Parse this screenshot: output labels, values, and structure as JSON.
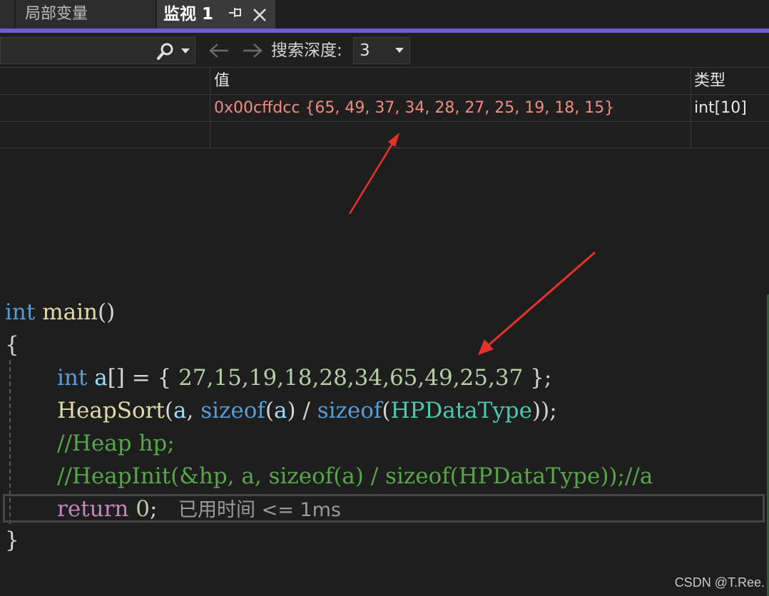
{
  "tabs": {
    "locals_label": "局部变量",
    "watch_label": "监视 1"
  },
  "toolbar": {
    "search_value": "",
    "depth_label": "搜索深度:",
    "depth_value": "3"
  },
  "watch": {
    "headers": {
      "value": "值",
      "type": "类型"
    },
    "row": {
      "value": "0x00cffdcc {65, 49, 37, 34, 28, 27, 25, 19, 18, 15}",
      "type": "int[10]"
    }
  },
  "code": {
    "l1_kw": "int",
    "l1_fn": "main",
    "l1_p": "()",
    "l2": "{",
    "l3_kw": "int",
    "l3_var": "a",
    "l3_p1": "[] = {",
    "l3_nums": "27,15,19,18,28,34,65,49,25,37",
    "l3_p2": "};",
    "l4_fn": "HeapSort",
    "l4_p1": "(",
    "l4_var1": "a",
    "l4_p2": ",",
    "l4_kw1": "sizeof",
    "l4_p3": "(",
    "l4_var2": "a",
    "l4_p4": ") /",
    "l4_kw2": "sizeof",
    "l4_p5": "(",
    "l4_typ": "HPDataType",
    "l4_p6": "));",
    "l5_cmt": "//Heap hp;",
    "l6_cmt": "//HeapInit(&hp, a, sizeof(a) / sizeof(HPDataType));//a",
    "l7_ctl": "return",
    "l7_num": "0",
    "l7_p": ";",
    "l7_perf": "已用时间 <= 1ms",
    "l8": "}"
  },
  "watermark": "CSDN @T.Ree.",
  "colors": {
    "accent": "#6e5bd6",
    "annotation_arrow": "#e8312a",
    "watch_value": "#f28b82"
  },
  "icons": {
    "pin": "pin-icon",
    "close": "close-icon",
    "search": "search-icon",
    "back": "arrow-left-icon",
    "forward": "arrow-right-icon",
    "dropdown": "chevron-down-icon"
  }
}
